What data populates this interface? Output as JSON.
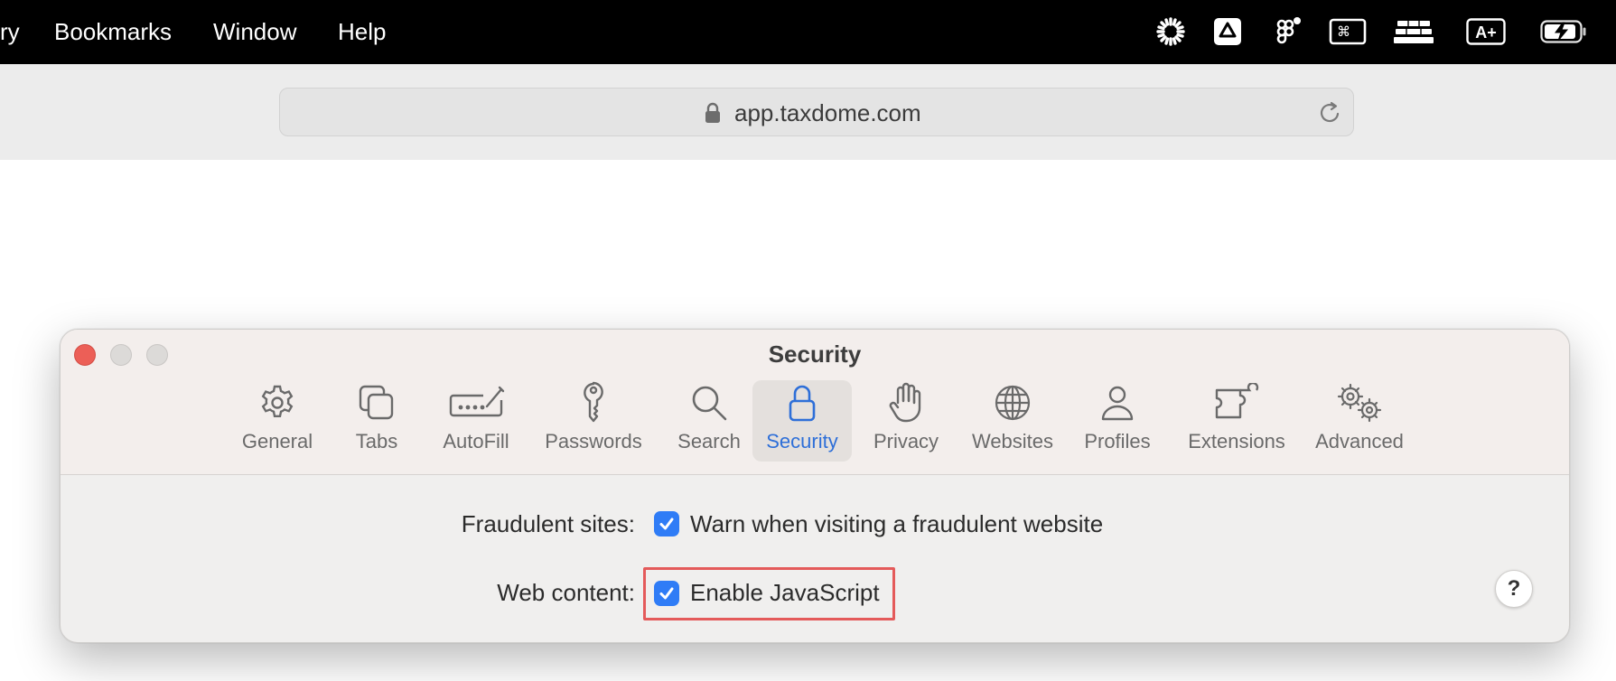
{
  "menubar": {
    "items": [
      "ry",
      "Bookmarks",
      "Window",
      "Help"
    ],
    "status_icons": [
      "loading-sun-icon",
      "google-drive-icon",
      "figma-icon",
      "command-key-icon",
      "keyboard-stack-icon",
      "text-size-icon",
      "battery-charging-icon"
    ],
    "text_size_label": "A+"
  },
  "toolbar": {
    "address": "app.taxdome.com"
  },
  "settings": {
    "title": "Security",
    "tabs": [
      {
        "label": "General",
        "icon": "gear-icon"
      },
      {
        "label": "Tabs",
        "icon": "tabs-icon"
      },
      {
        "label": "AutoFill",
        "icon": "autofill-pen-icon"
      },
      {
        "label": "Passwords",
        "icon": "key-icon"
      },
      {
        "label": "Search",
        "icon": "magnifier-icon"
      },
      {
        "label": "Security",
        "icon": "lock-icon",
        "active": true
      },
      {
        "label": "Privacy",
        "icon": "hand-icon"
      },
      {
        "label": "Websites",
        "icon": "globe-icon"
      },
      {
        "label": "Profiles",
        "icon": "person-icon"
      },
      {
        "label": "Extensions",
        "icon": "puzzle-icon"
      },
      {
        "label": "Advanced",
        "icon": "gears-icon"
      }
    ],
    "rows": {
      "fraudulent": {
        "label": "Fraudulent sites:",
        "checkbox_text": "Warn when visiting a fraudulent website",
        "checked": true
      },
      "web_content": {
        "label": "Web content:",
        "checkbox_text": "Enable JavaScript",
        "checked": true
      }
    },
    "help_label": "?"
  },
  "colors": {
    "accent": "#2f7cf6",
    "active_tab_label": "#2e6fd8",
    "highlight": "#e45a5a",
    "close_button": "#ec5f57"
  }
}
